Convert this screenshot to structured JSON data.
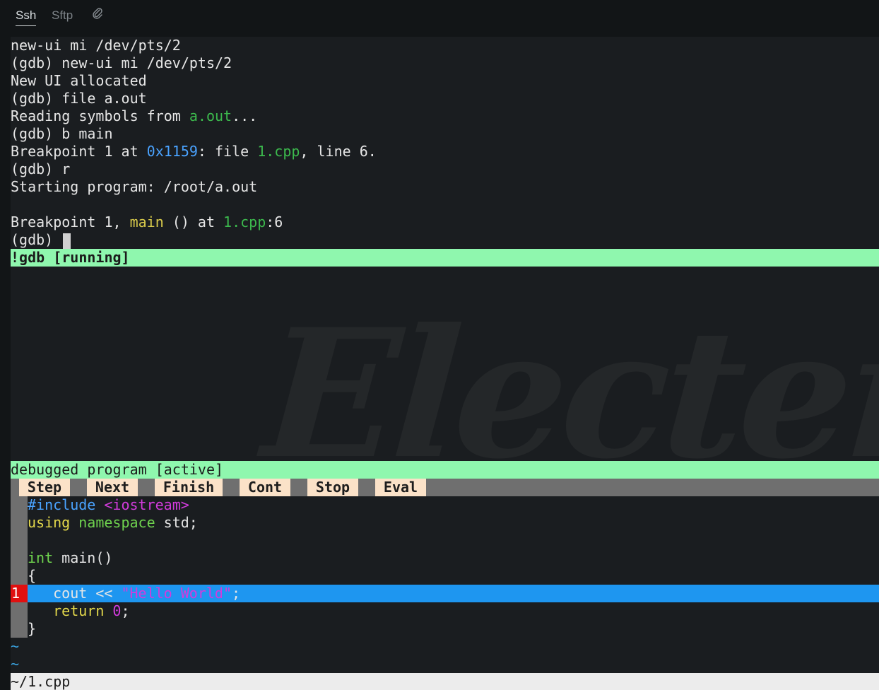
{
  "tabs": [
    {
      "label": "Ssh",
      "active": true
    },
    {
      "label": "Sftp",
      "active": false
    },
    {
      "icon": "paperclip-icon"
    }
  ],
  "gdb_output": {
    "l1": "new-ui mi /dev/pts/2",
    "l2": "(gdb) new-ui mi /dev/pts/2",
    "l3": "New UI allocated",
    "l4": "(gdb) file a.out",
    "l5a": "Reading symbols from ",
    "l5b": "a.out",
    "l5c": "...",
    "l6": "(gdb) b main",
    "l7a": "Breakpoint 1 at ",
    "l7b": "0x1159",
    "l7c": ": file ",
    "l7d": "1.cpp",
    "l7e": ", line 6.",
    "l8": "(gdb) r",
    "l9": "Starting program: /root/a.out",
    "l10a": "Breakpoint 1, ",
    "l10b": "main",
    "l10c": " () at ",
    "l10d": "1.cpp",
    "l10e": ":6",
    "l11": "(gdb) "
  },
  "status_top": "!gdb [running]",
  "watermark": "Electerm",
  "status_mid": "debugged program [active]",
  "toolbar": {
    "step": "Step",
    "next": "Next",
    "finish": "Finish",
    "cont": "Cont",
    "stop": "Stop",
    "eval": "Eval"
  },
  "source": {
    "line1a": "#include ",
    "line1b": "<iostream>",
    "line2a": "using",
    "line2b": " namespace",
    "line2c": " std;",
    "line4a": "int",
    "line4b": " main()",
    "line5": "{",
    "line6a": "   cout << ",
    "line6b": "\"Hello World\"",
    "line6c": ";",
    "line7a": "   return ",
    "line7b": "0",
    "line7c": ";",
    "line8": "}"
  },
  "breakpoint_marker": "1",
  "tilde": "~",
  "bottom_path": "~/1.cpp",
  "colors": {
    "status_bg": "#8ff7ae",
    "highlight": "#1e96f0",
    "breakpoint": "#e01010",
    "button_bg": "#fbe2c8"
  }
}
